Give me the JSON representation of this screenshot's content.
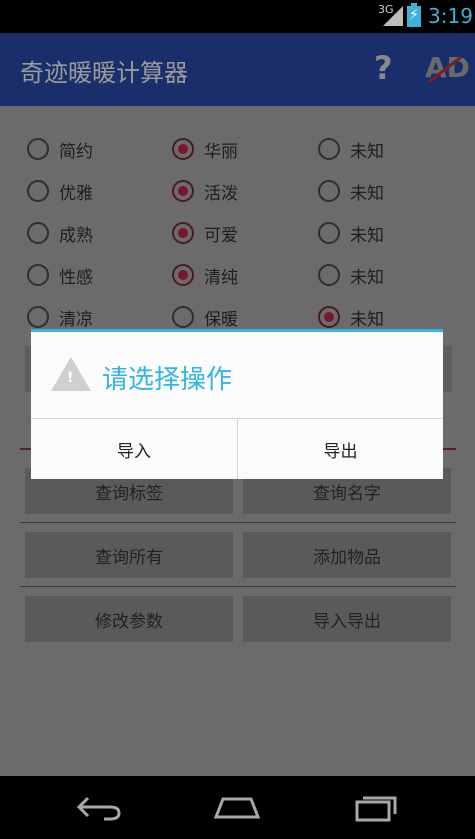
{
  "status_bar": {
    "network": "3G",
    "time": "3:19"
  },
  "action_bar": {
    "title": "奇迹暖暖计算器",
    "help_icon": "?",
    "ad_icon": "AD"
  },
  "radio_rows": [
    {
      "items": [
        {
          "label": "简约",
          "checked": false
        },
        {
          "label": "华丽",
          "checked": true
        },
        {
          "label": "未知",
          "checked": false
        }
      ]
    },
    {
      "items": [
        {
          "label": "优雅",
          "checked": false
        },
        {
          "label": "活泼",
          "checked": true
        },
        {
          "label": "未知",
          "checked": false
        }
      ]
    },
    {
      "items": [
        {
          "label": "成熟",
          "checked": false
        },
        {
          "label": "可爱",
          "checked": true
        },
        {
          "label": "未知",
          "checked": false
        }
      ]
    },
    {
      "items": [
        {
          "label": "性感",
          "checked": false
        },
        {
          "label": "清纯",
          "checked": true
        },
        {
          "label": "未知",
          "checked": false
        }
      ]
    },
    {
      "items": [
        {
          "label": "清凉",
          "checked": false
        },
        {
          "label": "保暖",
          "checked": false
        },
        {
          "label": "未知",
          "checked": true
        }
      ]
    }
  ],
  "buttons": {
    "query_tag": "查询标签",
    "query_name": "查询名字",
    "query_all": "查询所有",
    "add_item": "添加物品",
    "modify_params": "修改参数",
    "import_export": "导入导出"
  },
  "dialog": {
    "title": "请选择操作",
    "import_label": "导入",
    "export_label": "导出"
  },
  "colors": {
    "accent": "#33b5e5",
    "action_bar": "#1b2e6c"
  }
}
